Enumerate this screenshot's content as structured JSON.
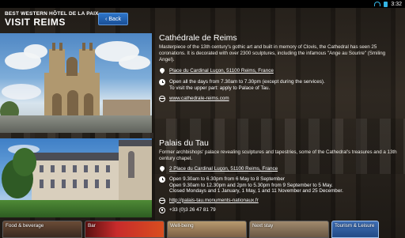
{
  "status_bar": {
    "time": "3:32"
  },
  "header": {
    "hotel_name": "BEST WESTERN HÔTEL DE LA PAIX ••••",
    "title": "VISIT REIMS",
    "back_label": "Back"
  },
  "places": [
    {
      "name": "Cathédrale de Reims",
      "description": "Masterpiece of the 13th century's gothic art and built in memory of Clovis, the Cathedral has seen 25 coronations. It is decorated with over 2300 sculptures, including the infamous \"Ange au Sourire\" (Smiling Angel).",
      "address": "Place du Cardinal Luçon, 51100 Reims, France",
      "hours": "Open all the days from 7.30am to 7.30pm (except during the services).\nTo visit the upper part: apply to Palace of Tau.",
      "website": "www.cathedrale-reims.com"
    },
    {
      "name": "Palais du Tau",
      "description": "Former archbishops' palace revealing sculptures and tapestries, some of the Cathedral's treasures and a 13th century chapel.",
      "address": "2 Place du Cardinal Luçon, 51100 Reims, France",
      "hours": "Open 9.30am to 6.30pm from 6 May to 8 September\nOpen 9.30am to 12.30pm and 2pm to 5.30pm from 9 September to 5 May.\nClosed Mondays and 1 January, 1 May, 1 and 11 November and 25 December.",
      "website": "http://palais-tau.monuments-nationaux.fr",
      "phone": "+33 (0)3 26 47 81 79"
    }
  ],
  "tabs": [
    {
      "label": "Food & beverage"
    },
    {
      "label": "Bar"
    },
    {
      "label": "Well-being"
    },
    {
      "label": "Next stay"
    },
    {
      "label": "Tourism & Leisure"
    }
  ]
}
